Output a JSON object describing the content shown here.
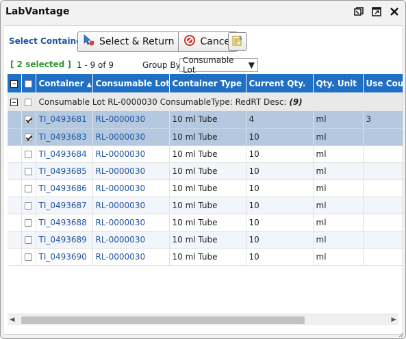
{
  "window": {
    "title": "LabVantage"
  },
  "toolbar": {
    "section_label": "Select Container",
    "select_return_label": "Select & Return",
    "cancel_label": "Cancel"
  },
  "status": {
    "selected": "[ 2 selected ]",
    "range": "1 - 9 of 9",
    "group_by_label": "Group By",
    "group_by_value": "Consumable Lot"
  },
  "columns": [
    "Container",
    "Consumable Lot",
    "Container Type",
    "Current Qty.",
    "Qty. Unit",
    "Use Count"
  ],
  "group": {
    "label": "Consumable Lot RL-0000030 ConsumableType: RedRT Desc:",
    "count": "(9)"
  },
  "rows": [
    {
      "container": "TI_0493681",
      "lot": "RL-0000030",
      "type": "10 ml Tube",
      "qty": "4",
      "unit": "ml",
      "use": "3",
      "checked": true
    },
    {
      "container": "TI_0493683",
      "lot": "RL-0000030",
      "type": "10 ml Tube",
      "qty": "10",
      "unit": "ml",
      "use": "",
      "checked": true
    },
    {
      "container": "TI_0493684",
      "lot": "RL-0000030",
      "type": "10 ml Tube",
      "qty": "10",
      "unit": "ml",
      "use": "",
      "checked": false
    },
    {
      "container": "TI_0493685",
      "lot": "RL-0000030",
      "type": "10 ml Tube",
      "qty": "10",
      "unit": "ml",
      "use": "",
      "checked": false
    },
    {
      "container": "TI_0493686",
      "lot": "RL-0000030",
      "type": "10 ml Tube",
      "qty": "10",
      "unit": "ml",
      "use": "",
      "checked": false
    },
    {
      "container": "TI_0493687",
      "lot": "RL-0000030",
      "type": "10 ml Tube",
      "qty": "10",
      "unit": "ml",
      "use": "",
      "checked": false
    },
    {
      "container": "TI_0493688",
      "lot": "RL-0000030",
      "type": "10 ml Tube",
      "qty": "10",
      "unit": "ml",
      "use": "",
      "checked": false
    },
    {
      "container": "TI_0493689",
      "lot": "RL-0000030",
      "type": "10 ml Tube",
      "qty": "10",
      "unit": "ml",
      "use": "",
      "checked": false
    },
    {
      "container": "TI_0493690",
      "lot": "RL-0000030",
      "type": "10 ml Tube",
      "qty": "10",
      "unit": "ml",
      "use": "",
      "checked": false
    }
  ],
  "colors": {
    "header_bg": "#1f6fc4",
    "selected_row_bg": "#b4c9e0",
    "link": "#1f55a4",
    "selected_count": "#2c9a2c"
  }
}
